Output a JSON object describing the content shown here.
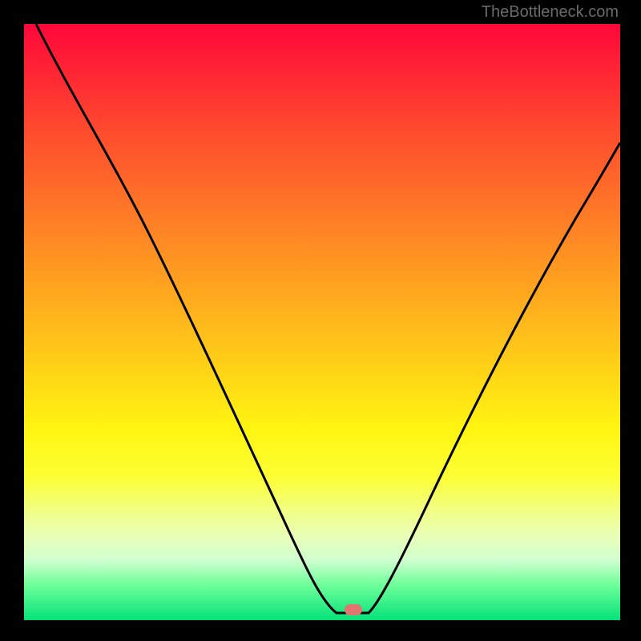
{
  "watermark": "TheBottleneck.com",
  "dot": {
    "x_pct": 54,
    "y_pct": 99
  },
  "chart_data": {
    "type": "line",
    "title": "",
    "xlabel": "",
    "ylabel": "",
    "xlim": [
      0,
      100
    ],
    "ylim": [
      0,
      100
    ],
    "series": [
      {
        "name": "curve",
        "x": [
          2,
          8,
          14,
          20,
          26,
          32,
          38,
          44,
          48,
          51,
          54,
          57,
          60,
          66,
          72,
          78,
          85,
          92,
          100
        ],
        "y": [
          100,
          91,
          81,
          70,
          61,
          51,
          40,
          27,
          14,
          4,
          0,
          0,
          3,
          14,
          27,
          39,
          52,
          64,
          76
        ]
      }
    ],
    "marker": {
      "x": 54,
      "y": 0
    },
    "background_gradient": [
      "#ff073a",
      "#fff511",
      "#05e27a"
    ]
  }
}
